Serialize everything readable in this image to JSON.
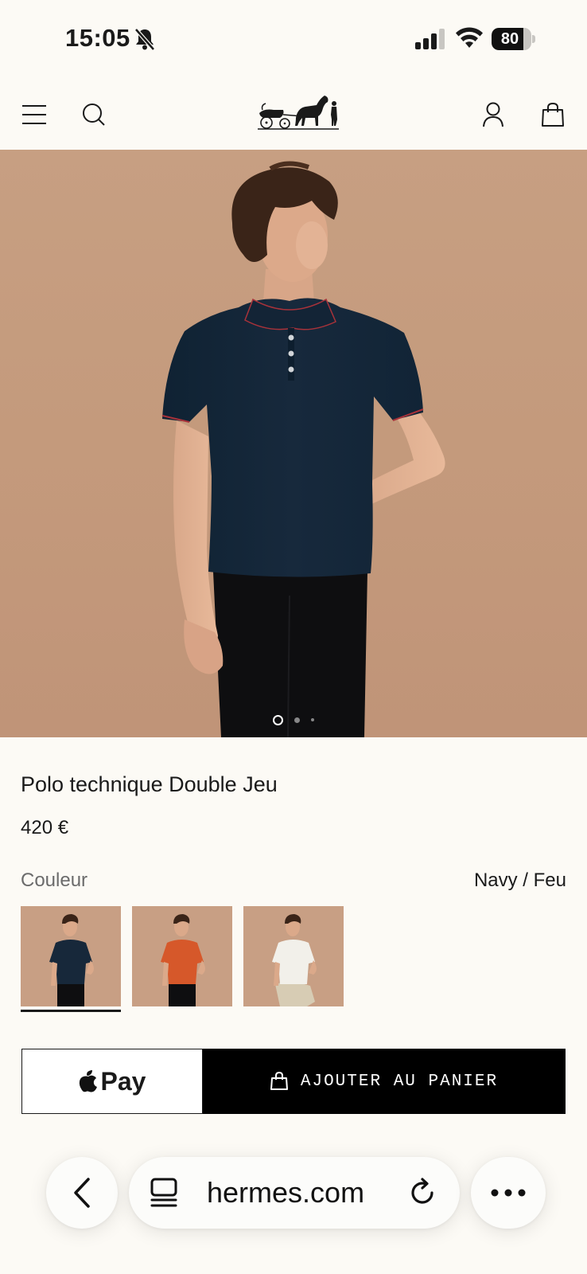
{
  "status_bar": {
    "time": "15:05",
    "battery_level": "80",
    "battery_fraction": 0.8
  },
  "header": {
    "icons": [
      "menu-icon",
      "search-icon",
      "hermes-logo",
      "account-icon",
      "shopping-bag-icon"
    ]
  },
  "gallery": {
    "image_count": 3,
    "active_index": 0
  },
  "product": {
    "title": "Polo technique Double Jeu",
    "price": "420 €",
    "color_label": "Couleur",
    "color_value": "Navy / Feu",
    "swatches": [
      {
        "color": "#17283a",
        "selected": true
      },
      {
        "color": "#d6582a",
        "selected": false
      },
      {
        "color": "#f2f0ea",
        "selected": false
      }
    ]
  },
  "actions": {
    "apple_pay_label": "Pay",
    "add_to_cart_label": "AJOUTER AU PANIER"
  },
  "browser": {
    "url": "hermes.com"
  },
  "colors": {
    "background": "#fcfaf5",
    "hero_background": "#c49a7c",
    "shirt_navy": "#17283a",
    "button_black": "#000000"
  }
}
